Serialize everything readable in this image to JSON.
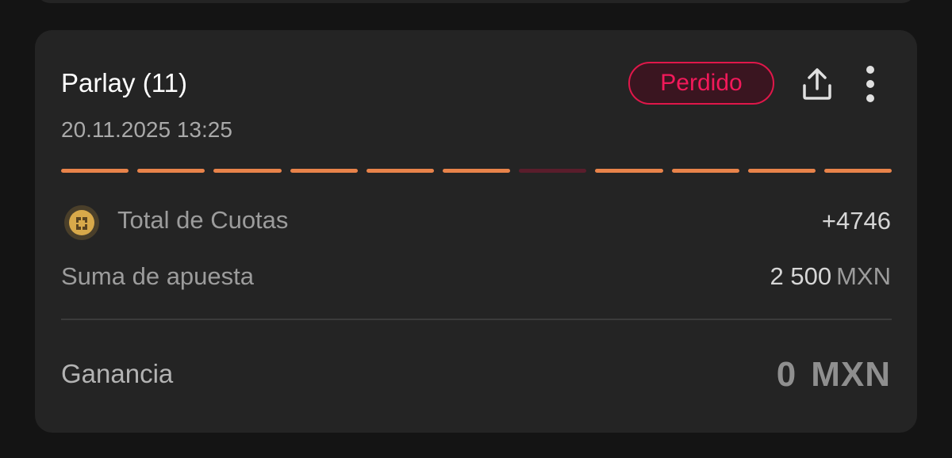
{
  "bet": {
    "title": "Parlay (11)",
    "date": "20.11.2025 13:25",
    "status": "Perdido",
    "legs": [
      "won",
      "won",
      "won",
      "won",
      "won",
      "won",
      "lost",
      "won",
      "won",
      "won",
      "won"
    ],
    "odds_label": "Total de Cuotas",
    "odds_value": "+4746",
    "stake_label": "Suma de apuesta",
    "stake_amount": "2 500",
    "stake_currency": "MXN",
    "win_label": "Ganancia",
    "win_amount": "0",
    "win_currency": "MXN"
  },
  "icons": {
    "share": "share-icon",
    "more": "more-vertical-icon",
    "coin": "coin-icon"
  },
  "colors": {
    "leg_won": "#e8834a",
    "leg_lost": "#5a1d2c",
    "status_lost": "#f2195a"
  }
}
